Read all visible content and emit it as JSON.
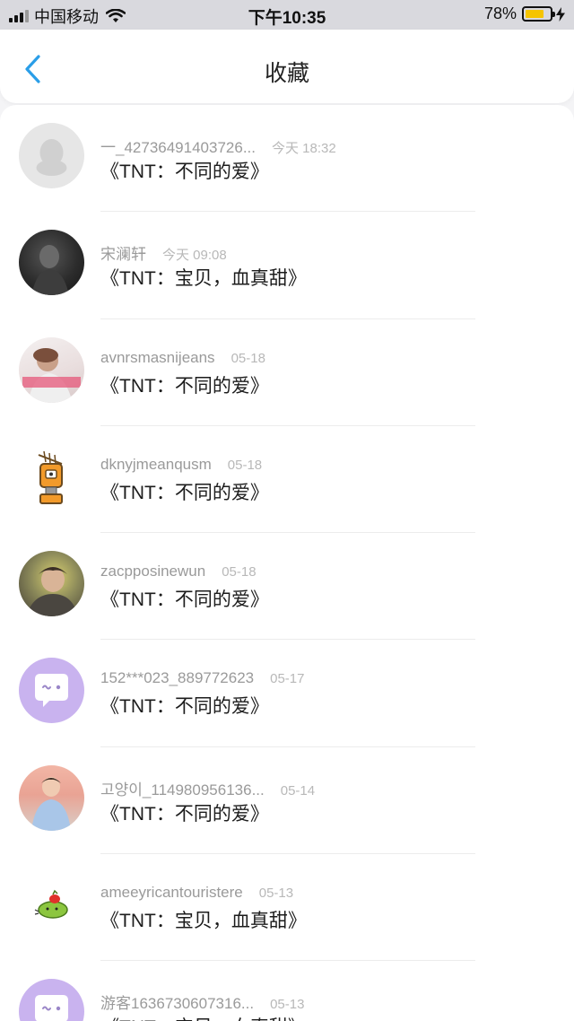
{
  "status_bar": {
    "carrier": "中国移动",
    "time": "下午10:35",
    "battery_percent": "78%",
    "battery_level": 0.78,
    "icons": [
      "signal-icon",
      "wifi-icon",
      "battery-icon",
      "charging-icon"
    ]
  },
  "nav": {
    "title": "收藏",
    "back_icon": "chevron-left-icon",
    "accent_color": "#2a9ee8"
  },
  "favorites": [
    {
      "username": "一_42736491403726...",
      "date": "今天 18:32",
      "work": "《TNT：不同的爱》",
      "avatar": "default-avatar"
    },
    {
      "username": "宋澜轩",
      "date": "今天 09:08",
      "work": "《TNT：宝贝，血真甜》",
      "avatar": "photo-avatar"
    },
    {
      "username": "avnrsmasnijeans",
      "date": "05-18",
      "work": "《TNT：不同的爱》",
      "avatar": "photo-avatar"
    },
    {
      "username": "dknyjmeanqusm",
      "date": "05-18",
      "work": "《TNT：不同的爱》",
      "avatar": "robot-avatar"
    },
    {
      "username": "zacpposinewun",
      "date": "05-18",
      "work": "《TNT：不同的爱》",
      "avatar": "photo-avatar"
    },
    {
      "username": "152***023_889772623",
      "date": "05-17",
      "work": "《TNT：不同的爱》",
      "avatar": "chat-bubble-avatar"
    },
    {
      "username": "고양이_114980956136...",
      "date": "05-14",
      "work": "《TNT：不同的爱》",
      "avatar": "photo-avatar"
    },
    {
      "username": "ameeyricantouristere",
      "date": "05-13",
      "work": "《TNT：宝贝，血真甜》",
      "avatar": "cartoon-avatar"
    },
    {
      "username": "游客1636730607316...",
      "date": "05-13",
      "work": "《TNT：宝贝，血真甜》",
      "avatar": "chat-bubble-avatar"
    }
  ]
}
